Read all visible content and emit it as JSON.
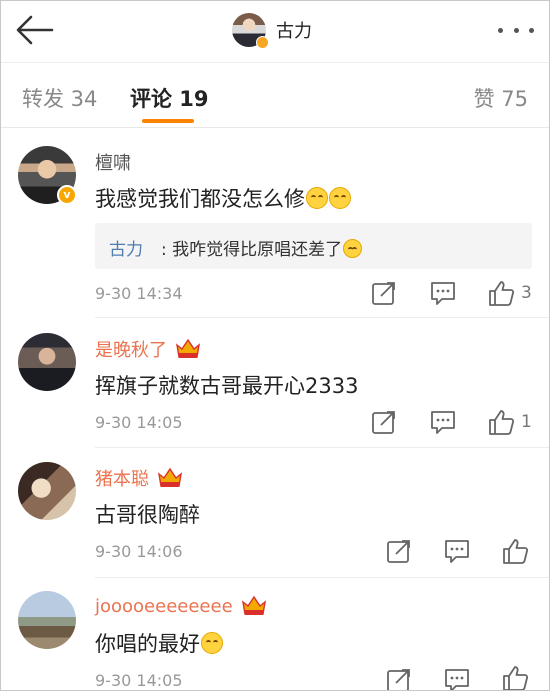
{
  "header": {
    "title": "古力",
    "avatar_icon": "user-avatar",
    "more_icon": "more-dots-icon",
    "back_icon": "back-arrow-icon"
  },
  "tabs": [
    {
      "label": "转发 34",
      "active": false
    },
    {
      "label": "评论 19",
      "active": true
    },
    {
      "label": "赞 75",
      "active": false
    }
  ],
  "accent_color": "#ff8200",
  "comments": [
    {
      "username": "檀啸",
      "vip": false,
      "verified": true,
      "text": "我感觉我们都没怎么修",
      "emojis": 2,
      "reply": {
        "name": "古力",
        "text": ": 我咋觉得比原唱还差了"
      },
      "time": "9-30 14:34",
      "likes": "3"
    },
    {
      "username": "是晚秋了",
      "vip": true,
      "text": "挥旗子就数古哥最开心2333",
      "emojis": 0,
      "time": "9-30 14:05",
      "likes": "1"
    },
    {
      "username": "猪本聪",
      "vip": true,
      "text": "古哥很陶醉",
      "emojis": 0,
      "time": "9-30 14:06",
      "likes": ""
    },
    {
      "username": "jooooeeeeeeee",
      "vip": true,
      "text": "你唱的最好",
      "emojis": 1,
      "time": "9-30 14:05",
      "likes": ""
    }
  ]
}
